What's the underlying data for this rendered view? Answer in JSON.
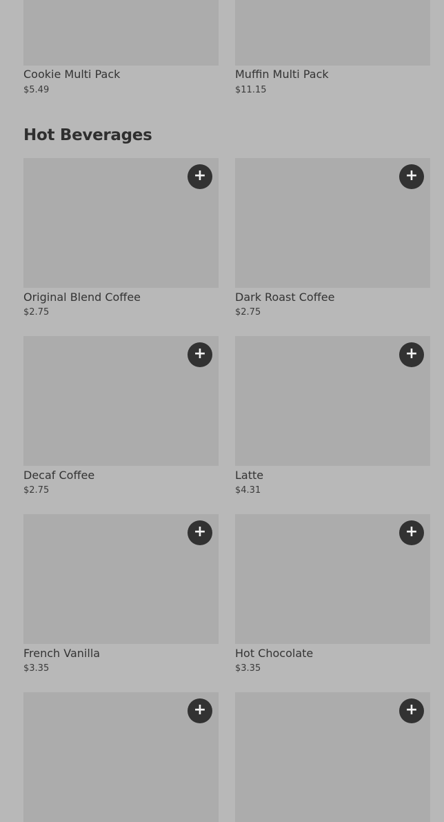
{
  "top_items": [
    {
      "name": "Cookie Multi Pack",
      "price": "$5.49"
    },
    {
      "name": "Muffin Multi Pack",
      "price": "$11.15"
    }
  ],
  "section": {
    "title": "Hot Beverages"
  },
  "add_icon": "plus-icon",
  "items": [
    {
      "name": "Original Blend Coffee",
      "price": "$2.75"
    },
    {
      "name": "Dark Roast Coffee",
      "price": "$2.75"
    },
    {
      "name": "Decaf Coffee",
      "price": "$2.75"
    },
    {
      "name": "Latte",
      "price": "$4.31"
    },
    {
      "name": "French Vanilla",
      "price": "$3.35"
    },
    {
      "name": "Hot Chocolate",
      "price": "$3.35"
    },
    {
      "name": "",
      "price": ""
    },
    {
      "name": "",
      "price": ""
    }
  ]
}
